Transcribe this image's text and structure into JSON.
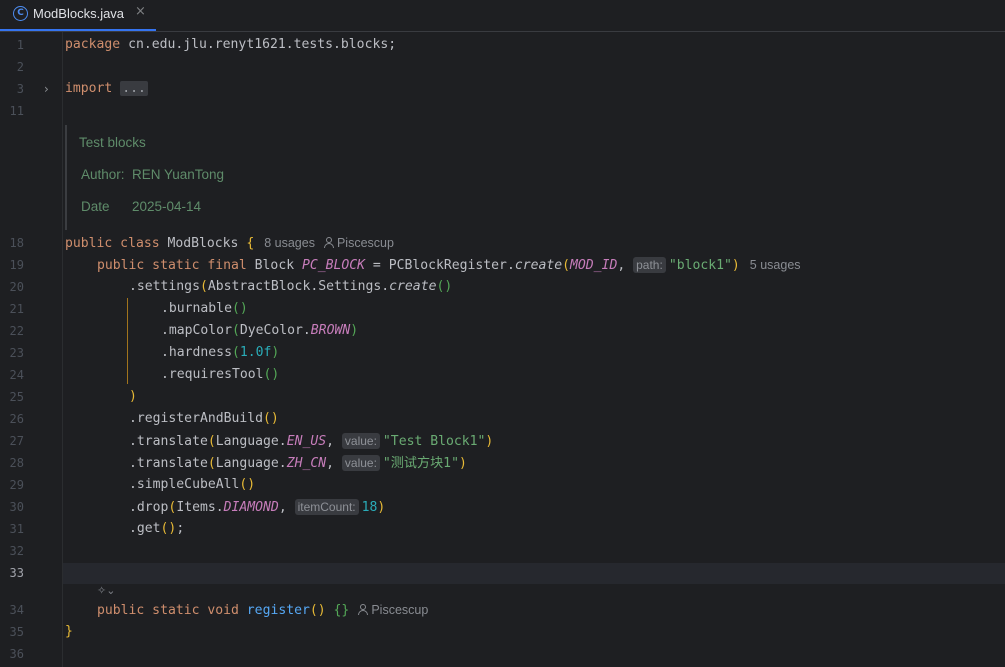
{
  "tab": {
    "name": "ModBlocks.java",
    "icon": "C",
    "close": "×"
  },
  "javadoc": {
    "title": "Test blocks",
    "author_label": "Author:",
    "author": "REN YuanTong",
    "date_label": "Date",
    "date": "2025-04-14"
  },
  "lines": [
    {
      "n": "1"
    },
    {
      "n": "2"
    },
    {
      "n": "3"
    },
    {
      "n": "11"
    },
    {
      "n": "18"
    },
    {
      "n": "19"
    },
    {
      "n": "20"
    },
    {
      "n": "21"
    },
    {
      "n": "22"
    },
    {
      "n": "23"
    },
    {
      "n": "24"
    },
    {
      "n": "25"
    },
    {
      "n": "26"
    },
    {
      "n": "27"
    },
    {
      "n": "28"
    },
    {
      "n": "29"
    },
    {
      "n": "30"
    },
    {
      "n": "31"
    },
    {
      "n": "32"
    },
    {
      "n": "33"
    },
    {
      "n": "34"
    },
    {
      "n": "35"
    },
    {
      "n": "36"
    }
  ],
  "code": {
    "pkg_kw": "package",
    "pkg_name": " cn.edu.jlu.renyt1621.tests.blocks;",
    "import_kw": "import",
    "import_fold": "...",
    "class_decl": "public class",
    "class_name": " ModBlocks ",
    "brace_open": "{",
    "class_usages": "8 usages",
    "class_author": "Piscescup",
    "field_kw": "public static final",
    "field_type": " Block ",
    "field_name": "PC_BLOCK",
    "field_assign": " = PCBlockRegister.",
    "create_fn": "create",
    "paren_open": "(",
    "mod_id": "MOD_ID",
    "comma": ", ",
    "hint_path": "path:",
    "block_str": "\"block1\"",
    "paren_close": ")",
    "field_usages": "5 usages",
    "settings_a": ".settings",
    "settings_b": "AbstractBlock.Settings.",
    "settings_create": "create",
    "empty_parens": "()",
    "burnable": ".burnable",
    "mapcolor": ".mapColor",
    "dye": "DyeColor.",
    "brown": "BROWN",
    "hardness": ".hardness",
    "hardness_val": "1.0f",
    "requires_tool": ".requiresTool",
    "close_paren": ")",
    "register_build": ".registerAndBuild",
    "translate": ".translate",
    "language": "Language.",
    "en_us": "EN_US",
    "hint_value": "value:",
    "str_en": "\"Test Block1\"",
    "zh_cn": "ZH_CN",
    "str_zh": "\"测试方块1\"",
    "simple_cube": ".simpleCubeAll",
    "drop": ".drop",
    "items": "Items.",
    "diamond": "DIAMOND",
    "hint_item_count": "itemCount:",
    "item_count": "18",
    "get": ".get",
    "semicolon": ";",
    "method_kw": "public static void",
    "method_name": "register",
    "method_body": "{}",
    "method_author": "Piscescup",
    "brace_close": "}"
  }
}
